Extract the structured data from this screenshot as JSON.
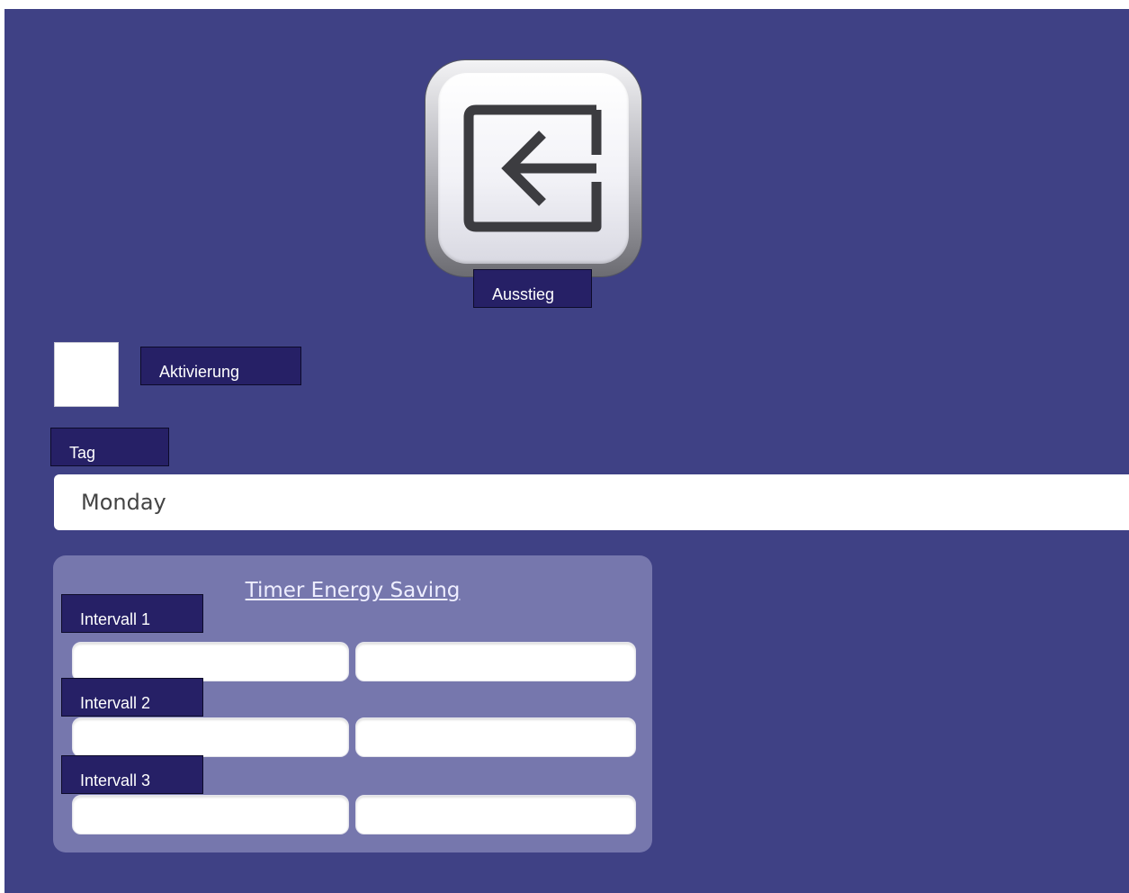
{
  "exit": {
    "label": "Ausstieg",
    "icon": "exit-icon"
  },
  "activation": {
    "label": "Aktivierung",
    "checked": false
  },
  "day": {
    "label": "Tag",
    "selected": "Monday"
  },
  "timer": {
    "title": "Timer Energy Saving",
    "intervals": [
      {
        "label": "Intervall 1",
        "start": "",
        "end": ""
      },
      {
        "label": "Intervall 2",
        "start": "",
        "end": ""
      },
      {
        "label": "Intervall 3",
        "start": "",
        "end": ""
      }
    ]
  },
  "colors": {
    "background": "#3f4185",
    "label_box": "#262066",
    "panel": "#7677ad"
  }
}
